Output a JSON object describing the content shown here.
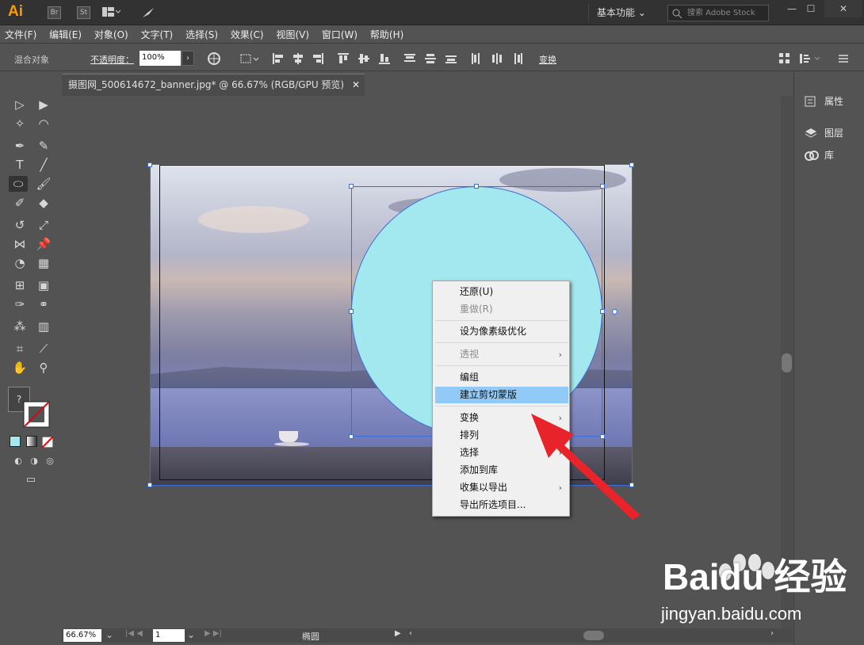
{
  "app": {
    "logo": "Ai",
    "bridge": "Br",
    "stock_app": "St",
    "workspace": "基本功能",
    "search_placeholder": "搜索 Adobe Stock",
    "minimize": "—",
    "maximize": "☐",
    "close": "✕"
  },
  "menu": [
    "文件(F)",
    "编辑(E)",
    "对象(O)",
    "文字(T)",
    "选择(S)",
    "效果(C)",
    "视图(V)",
    "窗口(W)",
    "帮助(H)"
  ],
  "control": {
    "selection": "混合对象",
    "opacity_label": "不透明度：",
    "opacity_value": "100%",
    "opacity_arrow": "›",
    "transform": "变换"
  },
  "document": {
    "tab_title": "摄图网_500614672_banner.jpg* @ 66.67% (RGB/GPU 预览)",
    "close": "✕"
  },
  "context_menu": [
    {
      "label": "还原(U)",
      "disabled": false,
      "submenu": false
    },
    {
      "label": "重做(R)",
      "disabled": true,
      "submenu": false
    },
    {
      "label": "设为像素级优化",
      "disabled": false,
      "submenu": false
    },
    {
      "label": "透视",
      "disabled": true,
      "submenu": true
    },
    {
      "label": "编组",
      "disabled": false,
      "submenu": false
    },
    {
      "label": "建立剪切蒙版",
      "disabled": false,
      "submenu": false,
      "highlighted": true
    },
    {
      "label": "变换",
      "disabled": false,
      "submenu": true
    },
    {
      "label": "排列",
      "disabled": false,
      "submenu": true
    },
    {
      "label": "选择",
      "disabled": false,
      "submenu": true
    },
    {
      "label": "添加到库",
      "disabled": false,
      "submenu": false
    },
    {
      "label": "收集以导出",
      "disabled": false,
      "submenu": true
    },
    {
      "label": "导出所选项目...",
      "disabled": false,
      "submenu": false
    }
  ],
  "right_panel": {
    "properties": "属性",
    "layers": "图层",
    "libraries": "库"
  },
  "status": {
    "zoom": "66.67%",
    "page": "1",
    "tool_name": "椭圆"
  },
  "watermark": {
    "brand": "Baidu 经验",
    "url": "jingyan.baidu.com"
  },
  "colors": {
    "accent": "#ff9a00",
    "selection": "#3b6fd8",
    "circle_fill": "#a3e8ee",
    "highlight": "#91c9f7",
    "arrow": "#e8232a"
  }
}
